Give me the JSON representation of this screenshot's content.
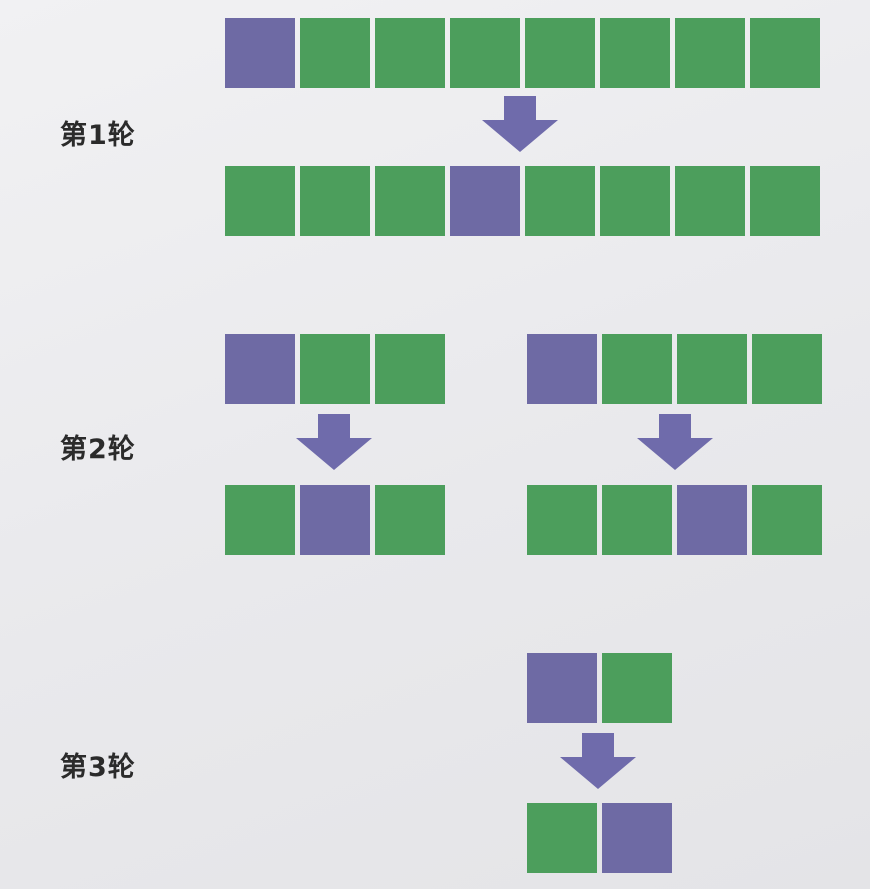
{
  "colors": {
    "green": "#4c9e5c",
    "purple": "#6e6aa4",
    "arrow": "#6f6bab"
  },
  "rounds": [
    {
      "label": "第1轮",
      "groups": [
        {
          "before": [
            "purple",
            "green",
            "green",
            "green",
            "green",
            "green",
            "green",
            "green"
          ],
          "after": [
            "green",
            "green",
            "green",
            "purple",
            "green",
            "green",
            "green",
            "green"
          ]
        }
      ]
    },
    {
      "label": "第2轮",
      "groups": [
        {
          "before": [
            "purple",
            "green",
            "green"
          ],
          "after": [
            "green",
            "purple",
            "green"
          ]
        },
        {
          "before": [
            "purple",
            "green",
            "green",
            "green"
          ],
          "after": [
            "green",
            "green",
            "purple",
            "green"
          ]
        }
      ]
    },
    {
      "label": "第3轮",
      "groups": [
        {
          "before": [
            "purple",
            "green"
          ],
          "after": [
            "green",
            "purple"
          ]
        }
      ]
    }
  ]
}
